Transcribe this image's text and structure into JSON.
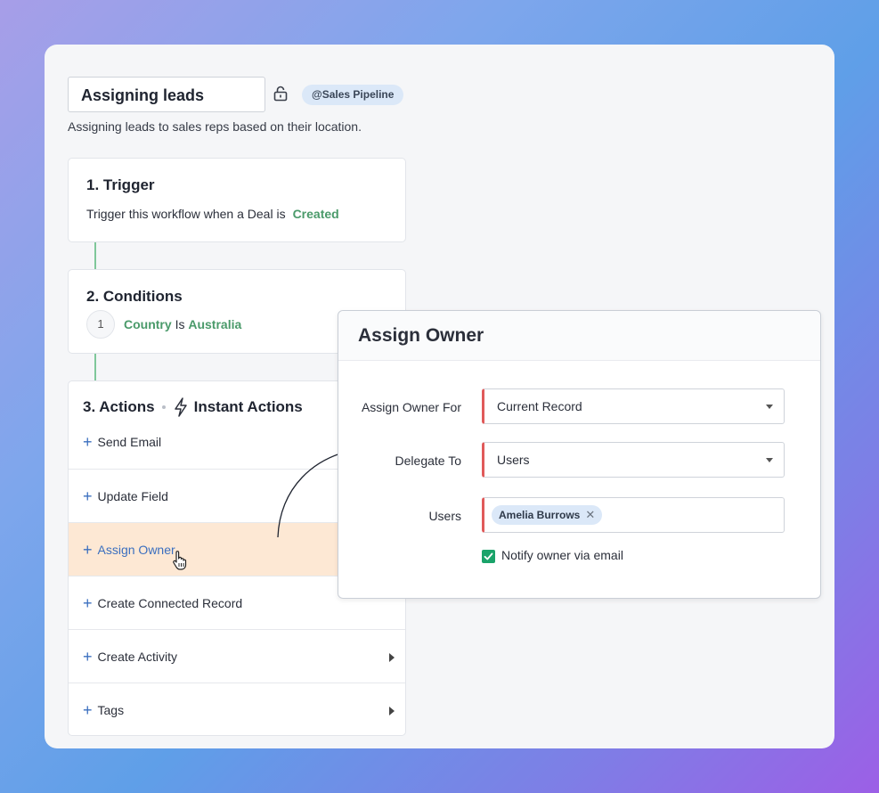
{
  "workflow": {
    "name": "Assigning leads",
    "tag": "@Sales Pipeline",
    "description": "Assigning leads to sales reps based on their location."
  },
  "trigger": {
    "title": "1. Trigger",
    "text": "Trigger this workflow when a Deal is",
    "value": "Created"
  },
  "conditions": {
    "title": "2. Conditions",
    "number": "1",
    "field": "Country",
    "operator": "Is",
    "value": "Australia"
  },
  "actions": {
    "title": "3. Actions",
    "instant_label": "Instant Actions",
    "plus_glyph": "+",
    "items": [
      {
        "label": "Send Email"
      },
      {
        "label": "Update Field"
      },
      {
        "label": "Assign Owner"
      },
      {
        "label": "Create Connected Record"
      },
      {
        "label": "Create Activity"
      },
      {
        "label": "Tags"
      }
    ]
  },
  "modal": {
    "title": "Assign Owner",
    "assign_for_label": "Assign Owner For",
    "assign_for_value": "Current Record",
    "delegate_label": "Delegate To",
    "delegate_value": "Users",
    "users_label": "Users",
    "user_chip": "Amelia Burrows",
    "chip_remove": "✕",
    "notify_label": "Notify owner via email",
    "notify_checked": true
  },
  "colors": {
    "accent_blue": "#3b6fbf",
    "green": "#4a9a6a",
    "highlight": "#fde8d4",
    "required": "#e05a5a",
    "checkbox": "#1aa36a"
  }
}
